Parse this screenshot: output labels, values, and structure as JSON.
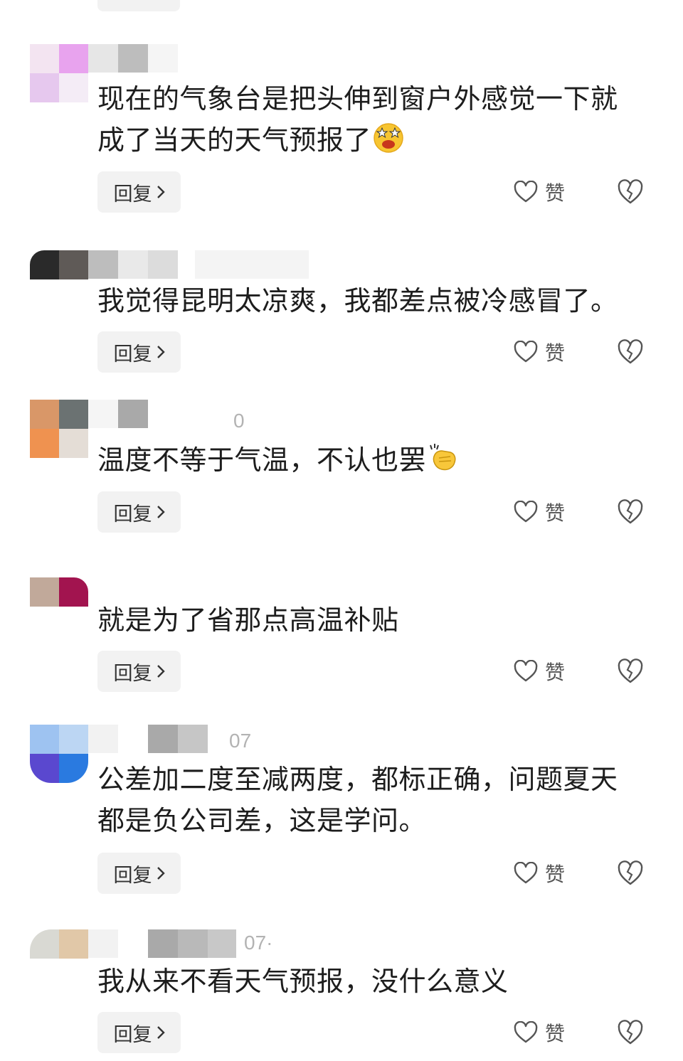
{
  "comments": [
    {
      "text_line1": "现在的气象台是把头伸到窗户外感觉一下就",
      "text_line2": "成了当天的天气预报了",
      "emoji": "star-struck-face-icon",
      "reply_label": "回复",
      "like_label": "赞",
      "meta": ""
    },
    {
      "text_line1": "我觉得昆明太凉爽，我都差点被冷感冒了。",
      "reply_label": "回复",
      "like_label": "赞",
      "meta": ""
    },
    {
      "text_line1": "温度不等于气温，不认也罢",
      "emoji": "clapping-hands-icon",
      "reply_label": "回复",
      "like_label": "赞",
      "meta": "0"
    },
    {
      "text_line1": "就是为了省那点高温补贴",
      "reply_label": "回复",
      "like_label": "赞",
      "meta": ""
    },
    {
      "text_line1": "公差加二度至减两度，都标正确，问题夏天",
      "text_line2": "都是负公司差，这是学问。",
      "reply_label": "回复",
      "like_label": "赞",
      "meta": "07"
    },
    {
      "text_line1": "我从来不看天气预报，没什么意义",
      "reply_label": "回复",
      "like_label": "赞",
      "meta": "07·"
    }
  ],
  "colors": {
    "text": "#1d1d1d",
    "meta": "#b3b3b3",
    "button_bg": "#f2f2f2",
    "icon_stroke": "#555555"
  }
}
